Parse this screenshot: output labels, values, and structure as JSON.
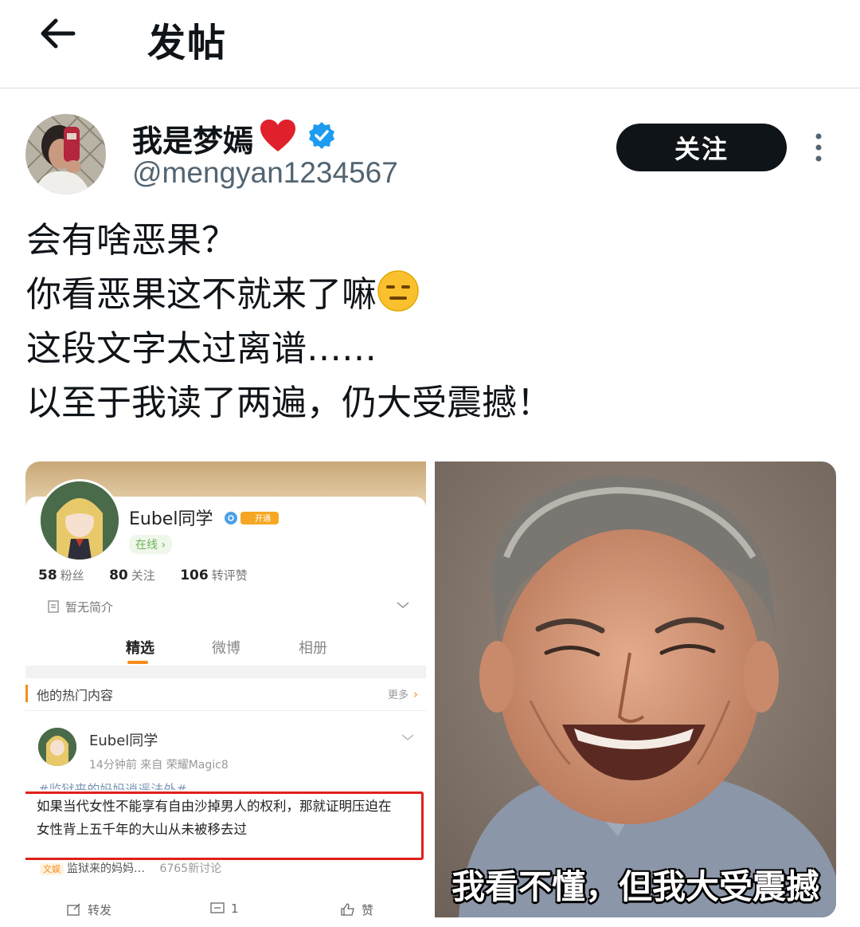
{
  "header": {
    "title": "发帖"
  },
  "author": {
    "display_name": "我是梦嫣",
    "handle": "@mengyan1234567",
    "follow_label": "关注"
  },
  "post": {
    "lines": [
      "会有啥恶果？",
      "你看恶果这不就来了嘛",
      "这段文字太过离谱……",
      "以至于我读了两遍，仍大受震撼！"
    ]
  },
  "weibo": {
    "name": "Eubel同学",
    "vip_label": "开通",
    "online": "在线 ›",
    "followers": "58",
    "followers_label": "粉丝",
    "following": "80",
    "following_label": "关注",
    "likes": "106",
    "likes_label": "转评赞",
    "bio": "暂无简介",
    "tabs": [
      "精选",
      "微博",
      "相册"
    ],
    "hot_title": "他的热门内容",
    "more_label": "更多",
    "post_name": "Eubel同学",
    "post_meta": "14分钟前   来自 荣耀Magic8",
    "topic": "#监狱来的妈妈逍遥法外#",
    "quote": "如果当代女性不能享有自由沙掉男人的权利，那就证明压迫在女性背上五千年的大山从未被移去过",
    "tag_pill": "文娱",
    "tag_title": "监狱来的妈妈…",
    "tag_count": "6765新讨论",
    "repost_label": "转发",
    "comment_count": "1",
    "like_label": "赞"
  },
  "meme": {
    "caption": "我看不懂，但我大受震撼"
  }
}
